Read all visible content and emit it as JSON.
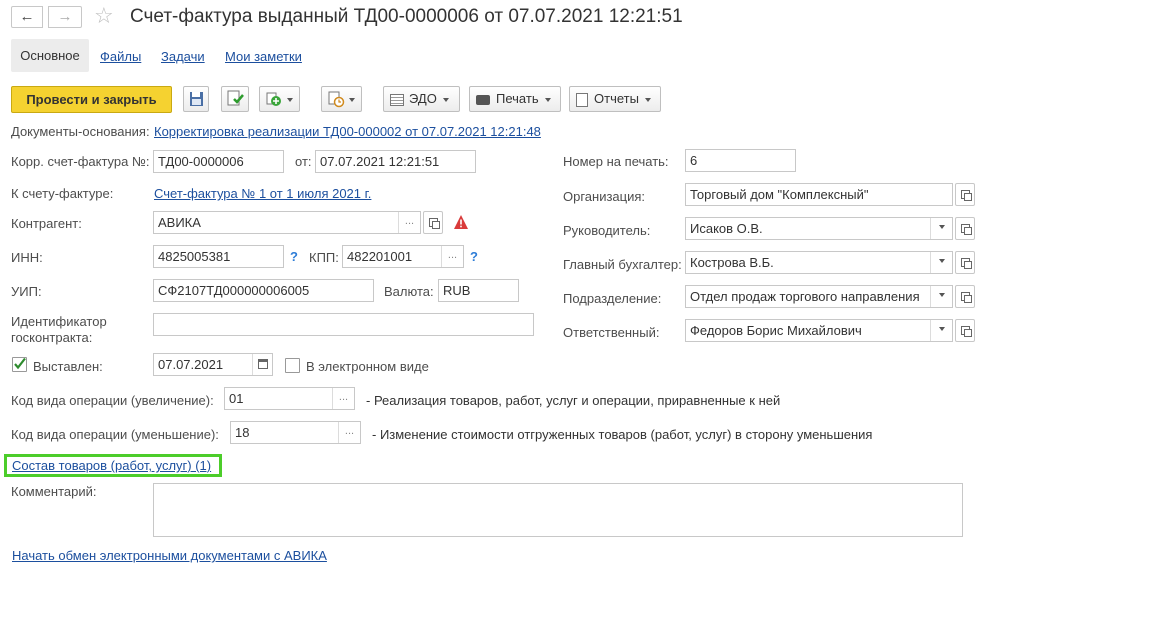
{
  "window": {
    "title": "Счет-фактура выданный ТД00-0000006 от 07.07.2021 12:21:51"
  },
  "tabs": [
    "Основное",
    "Файлы",
    "Задачи",
    "Мои заметки"
  ],
  "toolbar": {
    "post_close": "Провести и закрыть",
    "edo": "ЭДО",
    "print": "Печать",
    "reports": "Отчеты"
  },
  "form": {
    "base_docs_label": "Документы-основания:",
    "base_docs_link": "Корректировка реализации ТД00-000002 от 07.07.2021 12:21:48",
    "corr_invoice_label": "Корр. счет-фактура №:",
    "corr_invoice_number": "ТД00-0000006",
    "date_from_label": "от:",
    "date_from_value": "07.07.2021 12:21:51",
    "to_invoice_label": "К счету-фактуре:",
    "to_invoice_link": "Счет-фактура № 1 от 1 июля 2021 г.",
    "counterparty_label": "Контрагент:",
    "counterparty_value": "АВИКА",
    "inn_label": "ИНН:",
    "inn_value": "4825005381",
    "kpp_label": "КПП:",
    "kpp_value": "482201001",
    "question_mark": "?",
    "uip_label": "УИП:",
    "uip_value": "СФ2107ТД000000006005",
    "currency_label": "Валюта:",
    "currency_value": "RUB",
    "gov_contract_label_1": "Идентификатор",
    "gov_contract_label_2": "госконтракта:",
    "gov_contract_value": "",
    "issued_label": "Выставлен:",
    "issued_date": "07.07.2021",
    "electronic_label": "В электронном виде",
    "op_code_inc_label": "Код вида операции (увеличение):",
    "op_code_inc_value": "01",
    "op_code_inc_desc": "- Реализация товаров, работ, услуг и операции, приравненные к ней",
    "op_code_dec_label": "Код вида операции (уменьшение):",
    "op_code_dec_value": "18",
    "op_code_dec_desc": "- Изменение стоимости отгруженных товаров (работ, услуг) в сторону уменьшения",
    "goods_link": "Состав товаров (работ, услуг) (1)",
    "comment_label": "Комментарий:",
    "comment_value": "",
    "edo_link": "Начать обмен электронными документами с АВИКА",
    "print_number_label": "Номер на печать:",
    "print_number_value": "6",
    "org_label": "Организация:",
    "org_value": "Торговый дом \"Комплексный\"",
    "head_label": "Руководитель:",
    "head_value": "Исаков О.В.",
    "accountant_label": "Главный бухгалтер:",
    "accountant_value": "Кострова В.Б.",
    "division_label": "Подразделение:",
    "division_value": "Отдел продаж торгового направления",
    "responsible_label": "Ответственный:",
    "responsible_value": "Федоров Борис Михайлович"
  },
  "colors": {
    "accent_yellow": "#f5d230",
    "link_blue": "#1c4f9e",
    "highlight_green": "#4ccd2a",
    "warning_red": "#d93b3b"
  }
}
